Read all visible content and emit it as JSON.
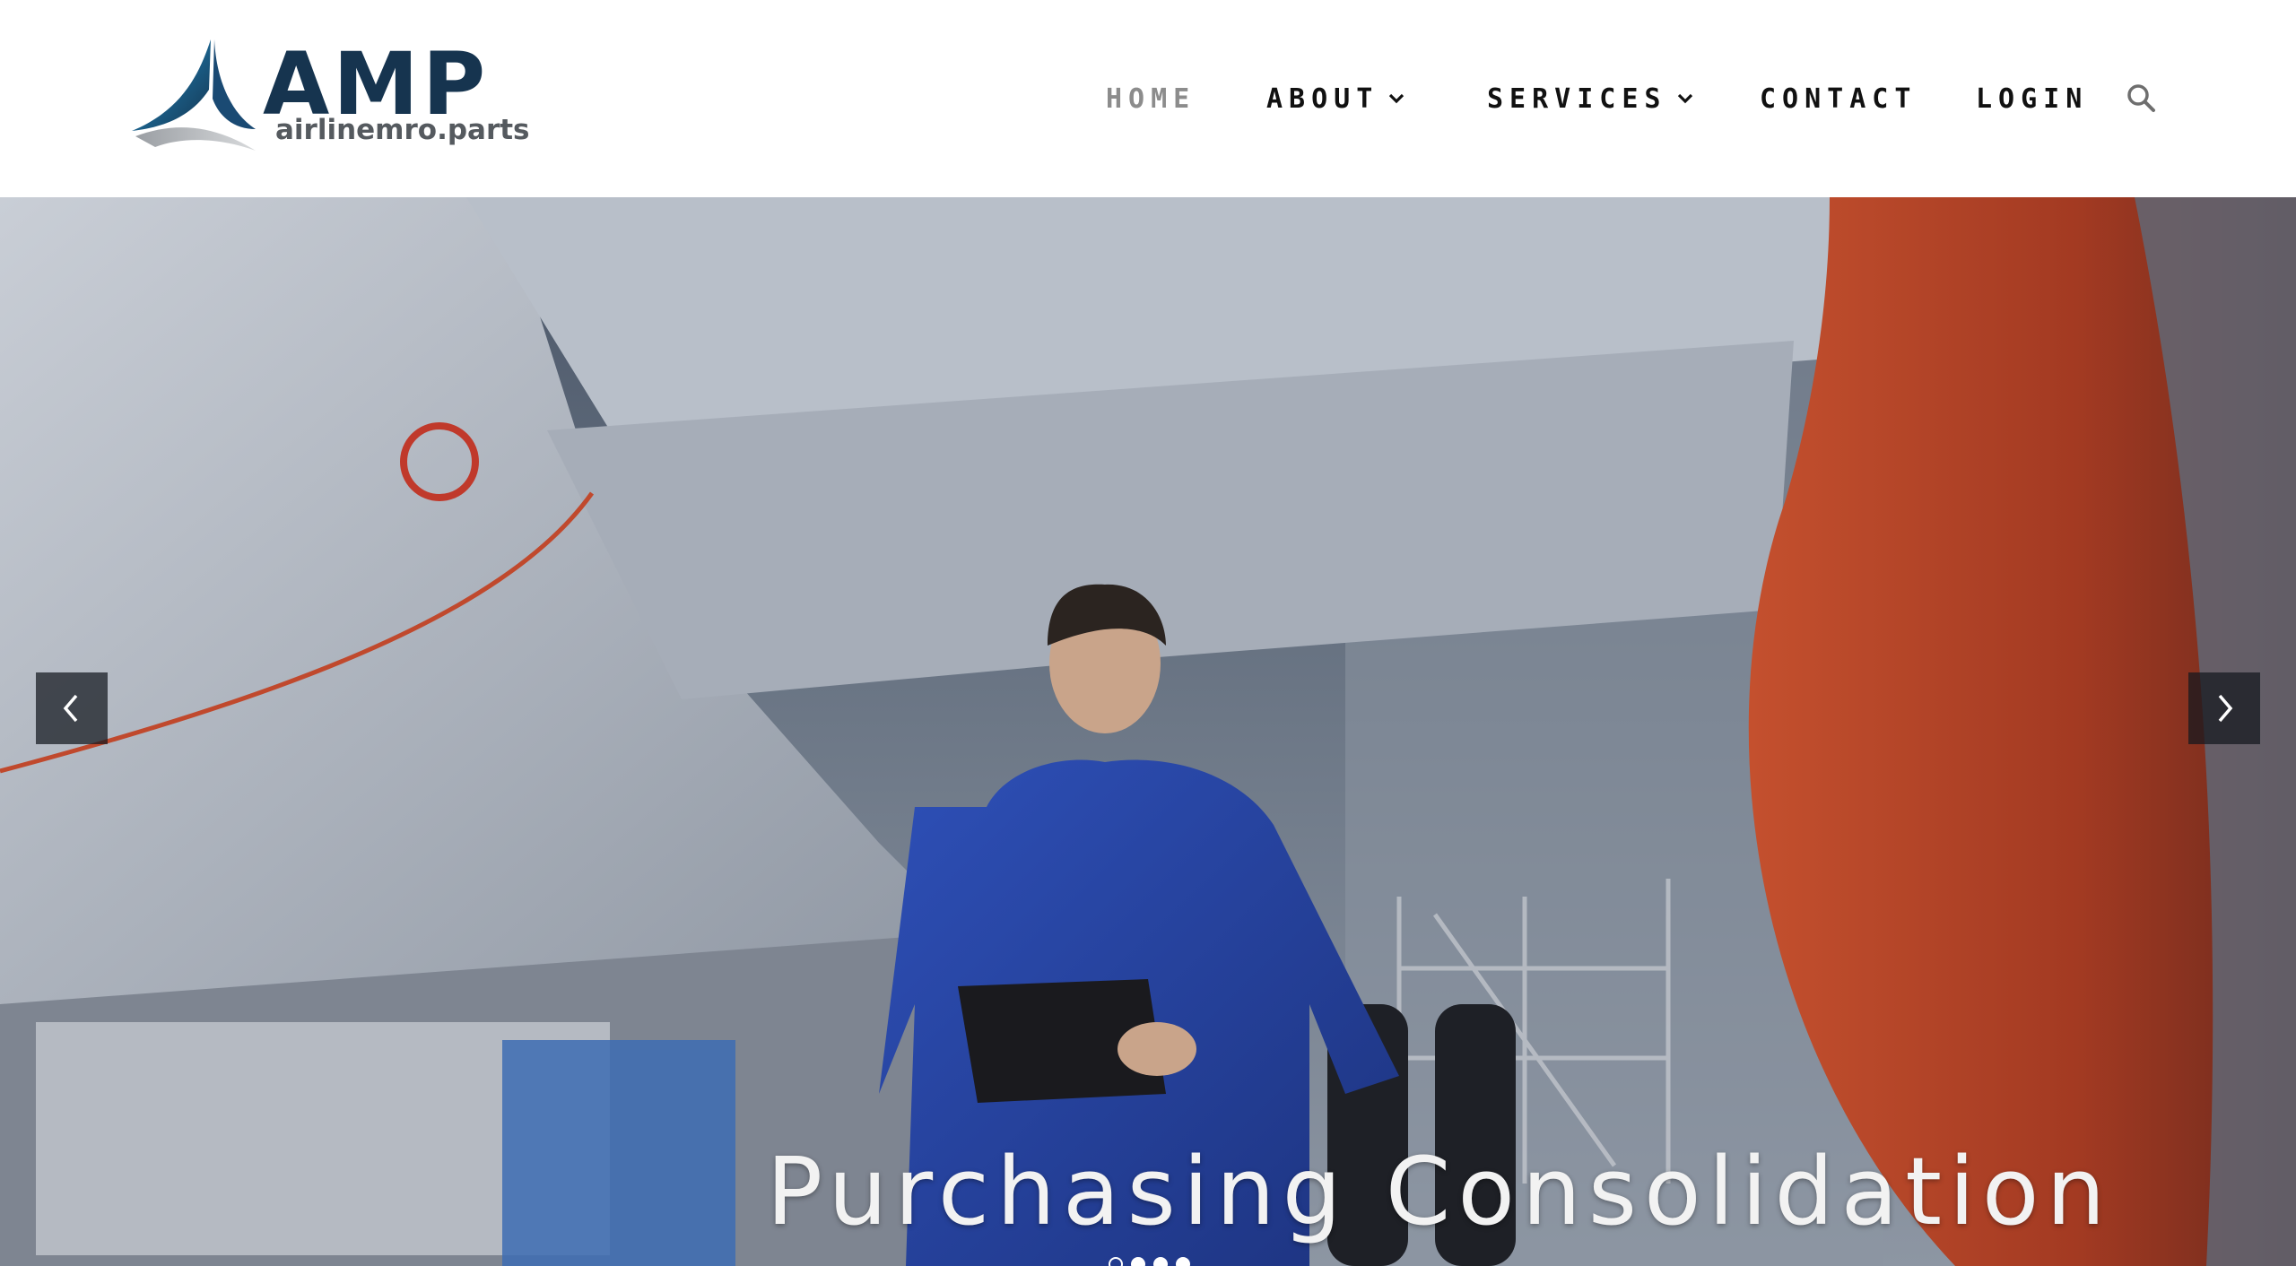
{
  "brand": {
    "name": "AMP",
    "domain": "airlinemro.parts",
    "colors": {
      "primary": "#16344f",
      "accent": "#1f8fc8",
      "subtext": "#555a5f"
    }
  },
  "nav": {
    "items": [
      {
        "label": "HOME",
        "active": true,
        "dropdown": false
      },
      {
        "label": "ABOUT",
        "active": false,
        "dropdown": true
      },
      {
        "label": "SERVICES",
        "active": false,
        "dropdown": true
      },
      {
        "label": "CONTACT",
        "active": false,
        "dropdown": false
      },
      {
        "label": "LOGIN",
        "active": false,
        "dropdown": false
      }
    ],
    "search_icon": "search-icon"
  },
  "hero": {
    "caption": "Purchasing Consolidation",
    "prev_icon": "chevron-left-icon",
    "next_icon": "chevron-right-icon",
    "slide_count": 4,
    "active_slide": 1
  }
}
